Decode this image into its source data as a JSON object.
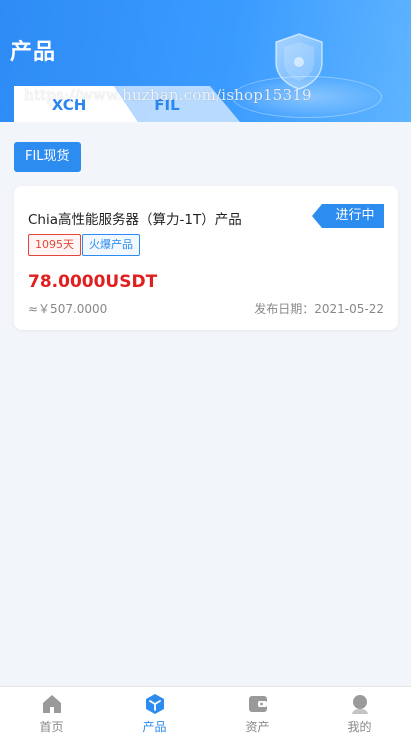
{
  "header": {
    "title": "产品",
    "watermark": "https://www.huzhan.com/ishop15319",
    "tabs": [
      {
        "label": "XCH",
        "active": true
      },
      {
        "label": "FIL",
        "active": false
      }
    ]
  },
  "filter": {
    "chip_label": "FIL现货"
  },
  "products": [
    {
      "name": "Chia高性能服务器（算力-1T）产品",
      "status": "进行中",
      "tags": [
        "1095天",
        "火爆产品"
      ],
      "price": "78.0000USDT",
      "cny_price": "≈￥507.0000",
      "publish_date": "发布日期：2021-05-22"
    }
  ],
  "tabbar": {
    "items": [
      {
        "label": "首页",
        "icon": "home-icon",
        "active": false
      },
      {
        "label": "产品",
        "icon": "cube-icon",
        "active": true
      },
      {
        "label": "资产",
        "icon": "wallet-icon",
        "active": false
      },
      {
        "label": "我的",
        "icon": "user-icon",
        "active": false
      }
    ]
  },
  "colors": {
    "primary": "#2d8cf0",
    "price_red": "#e02020",
    "days_tag": "#e2463a"
  }
}
